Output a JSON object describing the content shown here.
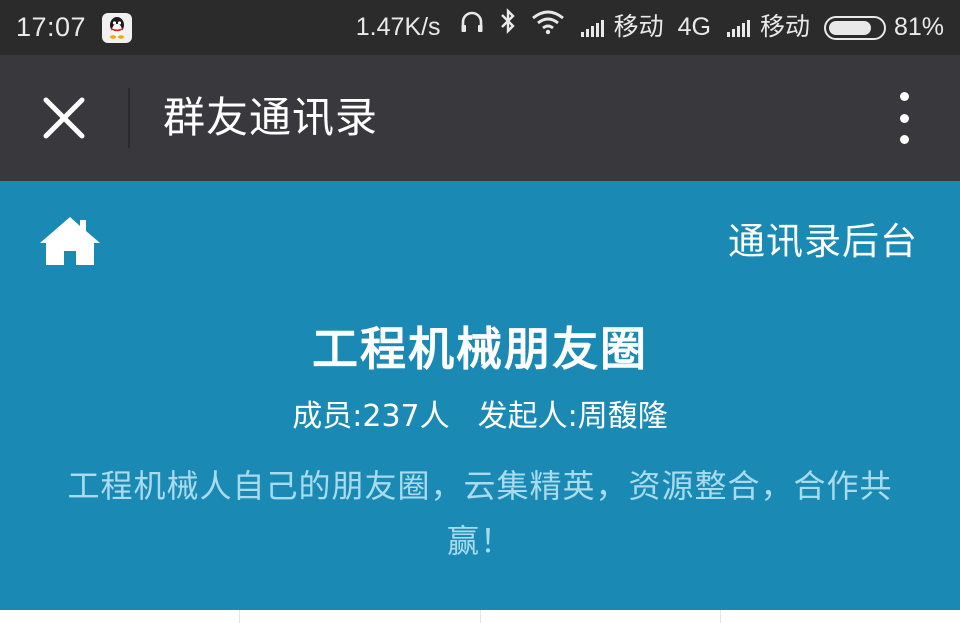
{
  "status_bar": {
    "time": "17:07",
    "network_speed": "1.47K/s",
    "carrier1": "移动",
    "network_type": "4G",
    "carrier2": "移动",
    "battery": "81%",
    "battery_level": 0.81
  },
  "title_bar": {
    "title": "群友通讯录"
  },
  "header": {
    "admin_link": "通讯录后台",
    "group_name": "工程机械朋友圈",
    "members": "成员:237人",
    "founder": "发起人:周馥隆",
    "description": "工程机械人自己的朋友圈，云集精英，资源整合，合作共赢！"
  },
  "colors": {
    "status_bar_bg": "#2b2b2b",
    "title_bar_bg": "#39393d",
    "header_bg": "#1a8ab4",
    "description_text": "#a9dbee"
  }
}
